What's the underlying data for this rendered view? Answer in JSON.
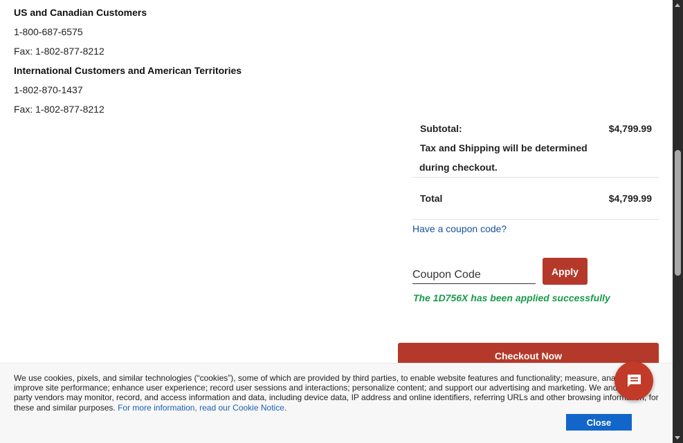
{
  "contact": {
    "us_heading": "US and Canadian Customers",
    "us_phone": "1-800-687-6575",
    "us_fax": "Fax: 1-802-877-8212",
    "intl_heading": "International Customers and American Territories",
    "intl_phone": "1-802-870-1437",
    "intl_fax": "Fax: 1-802-877-8212"
  },
  "summary": {
    "subtotal_label": "Subtotal:",
    "subtotal_value": "$4,799.99",
    "tax_line1": "Tax and Shipping will be determined",
    "tax_line2": "during checkout.",
    "total_label": "Total",
    "total_value": "$4,799.99"
  },
  "coupon": {
    "link_text": "Have a coupon code?",
    "placeholder": "Coupon Code",
    "apply_label": "Apply",
    "success_message": "The 1D756X has been applied successfully"
  },
  "checkout": {
    "button_label": "Checkout Now"
  },
  "cookie_banner": {
    "text_1": "We use cookies, pixels, and similar technologies (“cookies”), some of which are provided by third parties, to enable website features and functionality; measure, analyze, and improve site performance; enhance user experience; record user sessions and interactions; personalize content; and support our advertising and marketing. We and our third party vendors may monitor, record, and access information and data, including device data, IP address and online identifiers, referring URLs and other browsing information, for these and similar purposes.",
    "link_text": "For more information, read our Cookie Notice.",
    "close_label": "Close"
  },
  "colors": {
    "accent_red": "#b5392a",
    "success_green": "#1a9a4a",
    "link_blue": "#1a4f9c",
    "close_blue": "#1266c9"
  },
  "icons": {
    "chat": "chat-bubble-icon"
  }
}
